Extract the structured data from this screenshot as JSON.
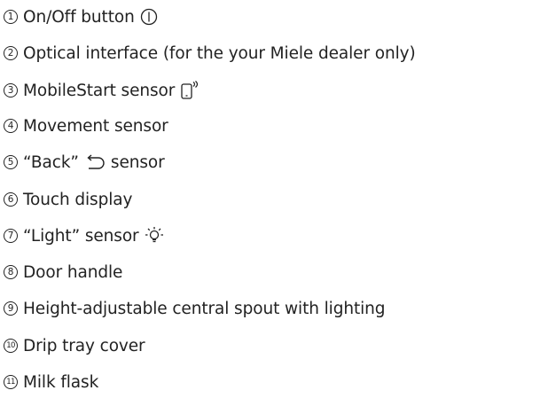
{
  "items": [
    {
      "number": "1",
      "text": "On/Off button",
      "icon": "power-button-icon"
    },
    {
      "number": "2",
      "text": "Optical interface (for the your Miele dealer only)"
    },
    {
      "number": "3",
      "text": "MobileStart sensor",
      "icon": "mobilestart-phone-icon"
    },
    {
      "number": "4",
      "text": "Movement sensor"
    },
    {
      "number": "5",
      "text_before": "“Back”",
      "text_after": "sensor",
      "icon": "back-arrow-icon"
    },
    {
      "number": "6",
      "text": "Touch display"
    },
    {
      "number": "7",
      "text": "“Light” sensor",
      "icon": "light-bulb-icon"
    },
    {
      "number": "8",
      "text": "Door handle"
    },
    {
      "number": "9",
      "text": "Height-adjustable central spout with lighting"
    },
    {
      "number": "10",
      "text": "Drip tray cover"
    },
    {
      "number": "11",
      "text": "Milk flask"
    }
  ]
}
